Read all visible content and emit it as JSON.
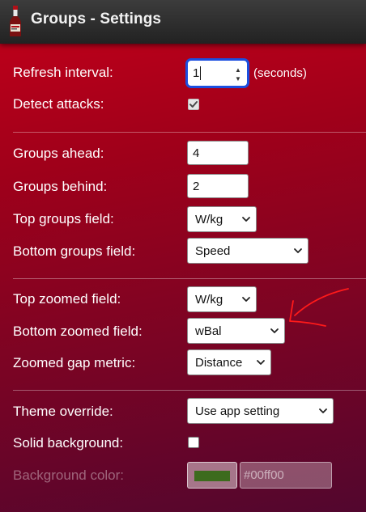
{
  "window": {
    "title": "Groups - Settings",
    "app_icon": "bottle-icon"
  },
  "general": {
    "refresh_label": "Refresh interval:",
    "refresh_value": "1",
    "refresh_suffix": "(seconds)",
    "detect_label": "Detect attacks:",
    "detect_checked": true
  },
  "groups": {
    "ahead_label": "Groups ahead:",
    "ahead_value": "4",
    "behind_label": "Groups behind:",
    "behind_value": "2",
    "top_field_label": "Top groups field:",
    "top_field_value": "W/kg",
    "bottom_field_label": "Bottom groups field:",
    "bottom_field_value": "Speed"
  },
  "zoomed": {
    "top_label": "Top zoomed field:",
    "top_value": "W/kg",
    "bottom_label": "Bottom zoomed field:",
    "bottom_value": "wBal",
    "gap_label": "Zoomed gap metric:",
    "gap_value": "Distance"
  },
  "appearance": {
    "theme_label": "Theme override:",
    "theme_value": "Use app setting",
    "solid_label": "Solid background:",
    "solid_checked": false,
    "bg_color_label": "Background color:",
    "bg_color_value": "#00ff00",
    "bg_color_swatch": "#3d6b1e"
  },
  "colors": {
    "focus_ring": "#1b4fe0",
    "annotation_arrow": "#ff1a1a"
  }
}
